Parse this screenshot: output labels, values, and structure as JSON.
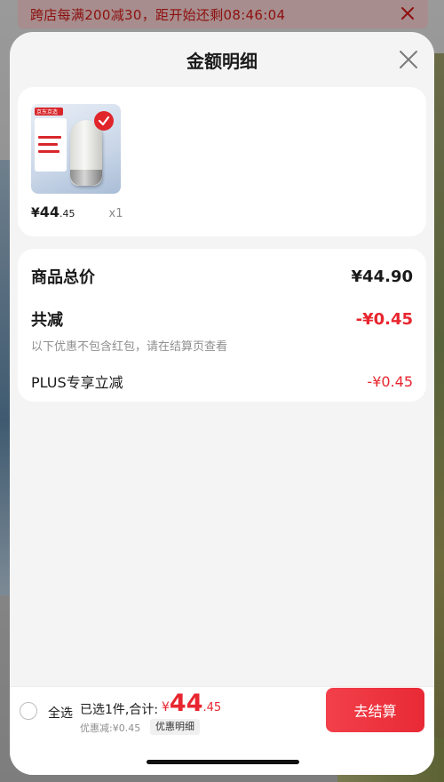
{
  "banner": {
    "text": "跨店每满200减30，距开始还剩08:46:04"
  },
  "sheet": {
    "title": "金额明细"
  },
  "product": {
    "thumb_tag": "京东京造",
    "price_yen": "¥",
    "price_int": "44",
    "price_dec": ".45",
    "quantity": "x1"
  },
  "summary": {
    "total_label": "商品总价",
    "total_value": "¥44.90",
    "discount_label": "共减",
    "discount_value": "-¥0.45",
    "discount_note": "以下优惠不包含红包，请在结算页查看",
    "plus_label": "PLUS专享立减",
    "plus_value": "-¥0.45"
  },
  "checkout": {
    "select_all": "全选",
    "selected_text": "已选1件,合计:",
    "total_yen": "¥",
    "total_int": "44",
    "total_dec": ".45",
    "discount_text": "优惠减:¥0.45",
    "detail_chip": "优惠明细",
    "pay_button": "去结算"
  },
  "colors": {
    "accent_red": "#e8262f",
    "banner_text": "#8e0f0f"
  },
  "icons": {
    "banner_close": "close-icon",
    "sheet_close": "close-icon",
    "product_badge": "checkmark-icon"
  }
}
